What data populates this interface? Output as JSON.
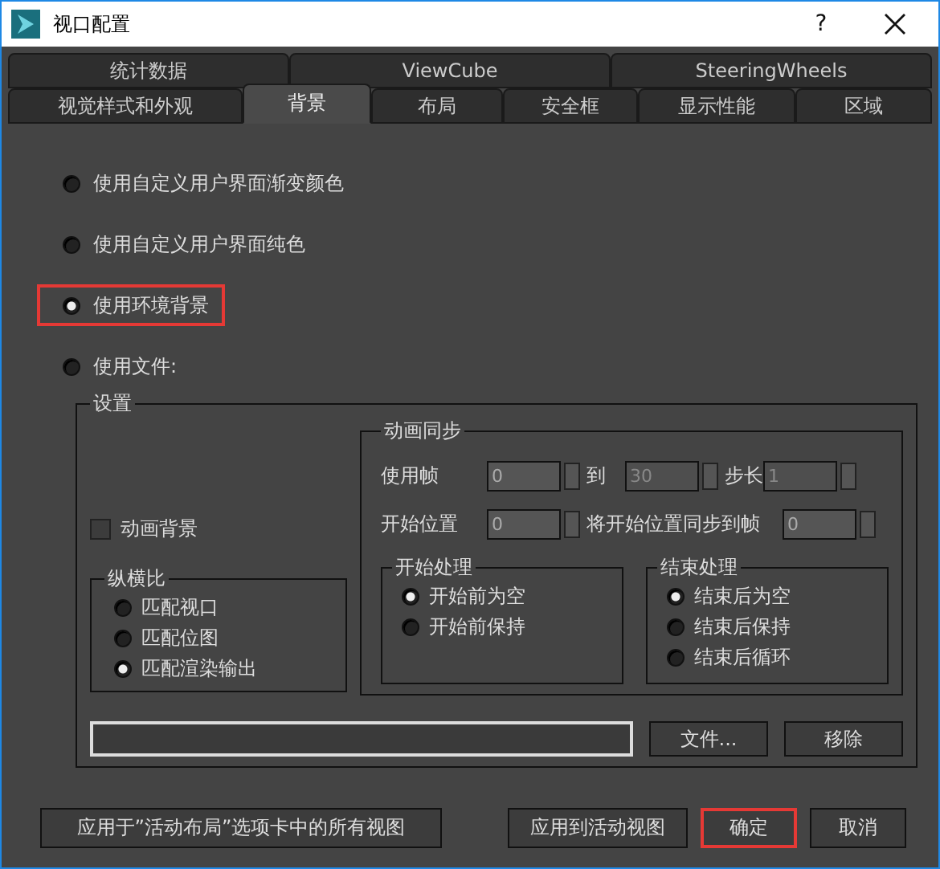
{
  "window": {
    "title": "视口配置",
    "help": "?"
  },
  "tabs_top": [
    {
      "label": "统计数据",
      "selected": false
    },
    {
      "label": "ViewCube",
      "selected": false
    },
    {
      "label": "SteeringWheels",
      "selected": false
    }
  ],
  "tabs_bottom": [
    {
      "label": "视觉样式和外观",
      "selected": false
    },
    {
      "label": "背景",
      "selected": true
    },
    {
      "label": "布局",
      "selected": false
    },
    {
      "label": "安全框",
      "selected": false
    },
    {
      "label": "显示性能",
      "selected": false
    },
    {
      "label": "区域",
      "selected": false
    }
  ],
  "background_modes": [
    {
      "label": "使用自定义用户界面渐变颜色",
      "selected": false,
      "highlighted": false
    },
    {
      "label": "使用自定义用户界面纯色",
      "selected": false,
      "highlighted": false
    },
    {
      "label": "使用环境背景",
      "selected": true,
      "highlighted": true
    },
    {
      "label": "使用文件:",
      "selected": false,
      "highlighted": false
    }
  ],
  "settings": {
    "title": "设置",
    "animate_background": {
      "label": "动画背景",
      "checked": false
    },
    "aspect_ratio": {
      "title": "纵横比",
      "options": [
        {
          "label": "匹配视口",
          "selected": false
        },
        {
          "label": "匹配位图",
          "selected": false
        },
        {
          "label": "匹配渲染输出",
          "selected": true
        }
      ]
    },
    "animation_sync": {
      "title": "动画同步",
      "use_frames": {
        "label": "使用帧",
        "from": "0",
        "to_label": "到",
        "to": "30",
        "step_label": "步长",
        "step": "1"
      },
      "start_position": {
        "label": "开始位置",
        "value": "0",
        "sync_label": "将开始位置同步到帧",
        "sync_value": "0"
      },
      "start_processing": {
        "title": "开始处理",
        "options": [
          {
            "label": "开始前为空",
            "selected": true
          },
          {
            "label": "开始前保持",
            "selected": false
          }
        ]
      },
      "end_processing": {
        "title": "结束处理",
        "options": [
          {
            "label": "结束后为空",
            "selected": true
          },
          {
            "label": "结束后保持",
            "selected": false
          },
          {
            "label": "结束后循环",
            "selected": false
          }
        ]
      }
    },
    "file_button": "文件...",
    "remove_button": "移除"
  },
  "buttons": [
    {
      "label": "应用于”活动布局”选项卡中的所有视图",
      "highlighted": false
    },
    {
      "label": "应用到活动视图",
      "highlighted": false
    },
    {
      "label": "确定",
      "highlighted": true
    },
    {
      "label": "取消",
      "highlighted": false
    }
  ]
}
